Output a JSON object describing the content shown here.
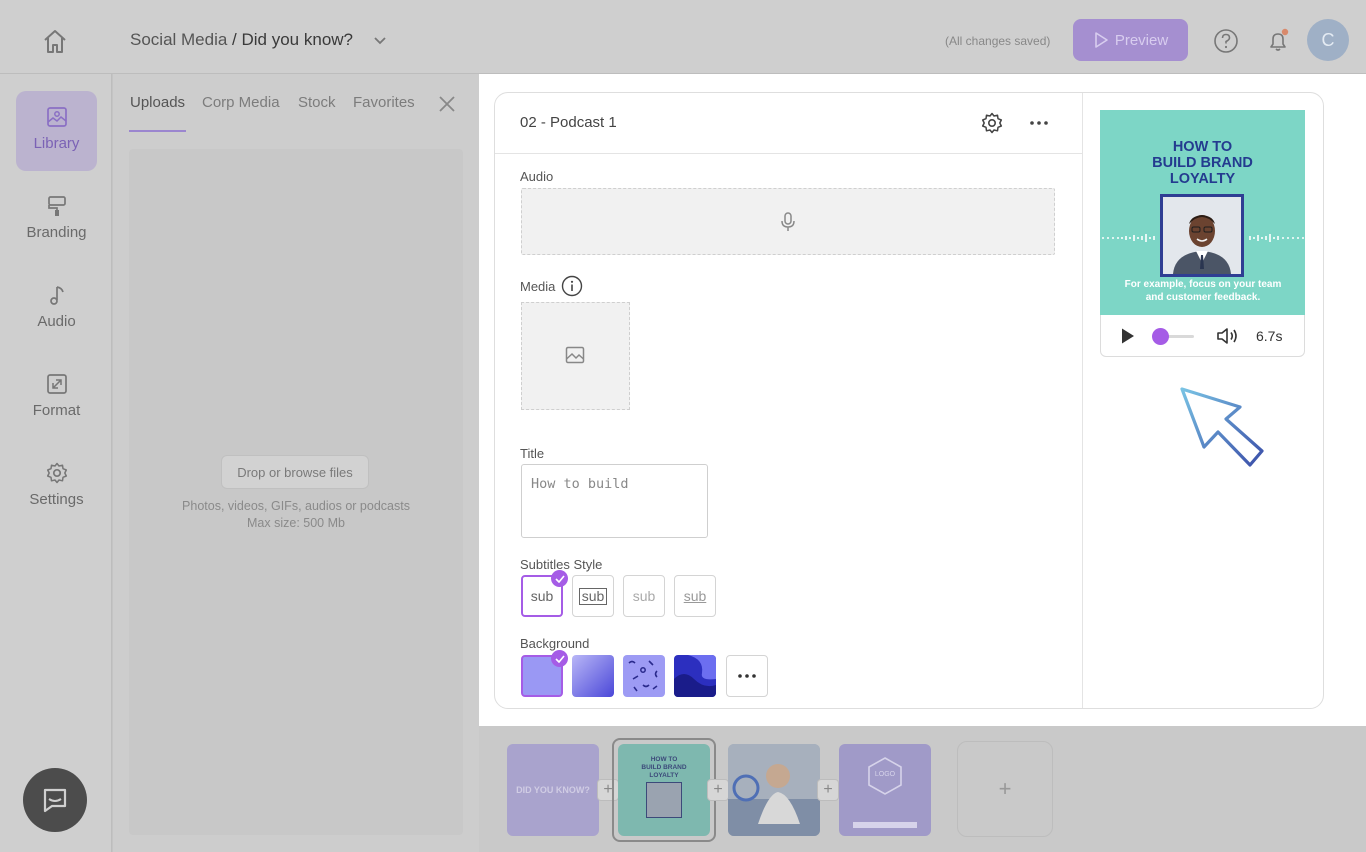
{
  "header": {
    "breadcrumb_parent": "Social Media",
    "breadcrumb_separator": " / ",
    "breadcrumb_current": "Did you know?",
    "save_status": "(All changes saved)",
    "preview_label": "Preview",
    "avatar_initial": "C"
  },
  "rail": {
    "items": [
      {
        "label": "Library",
        "icon": "image-icon",
        "active": true
      },
      {
        "label": "Branding",
        "icon": "paint-roller-icon"
      },
      {
        "label": "Audio",
        "icon": "music-note-icon"
      },
      {
        "label": "Format",
        "icon": "resize-icon"
      },
      {
        "label": "Settings",
        "icon": "gear-icon"
      }
    ]
  },
  "library": {
    "tabs": [
      "Uploads",
      "Corp Media",
      "Stock",
      "Favorites"
    ],
    "active_tab": "Uploads",
    "drop_button": "Drop or browse files",
    "hint_line1": "Photos, videos, GIFs, audios or podcasts",
    "hint_line2": "Max size: 500 Mb"
  },
  "editor": {
    "scene_title": "02 - Podcast 1",
    "audio_label": "Audio",
    "media_label": "Media",
    "title_label": "Title",
    "title_value": "How to build",
    "subtitles_label": "Subtitles Style",
    "subtitle_styles": [
      "sub",
      "sub",
      "sub",
      "sub"
    ],
    "selected_subtitle_style": 0,
    "background_label": "Background",
    "selected_background": 0,
    "accent_color": "#a55ce6"
  },
  "preview": {
    "headline": "HOW TO\nBUILD BRAND\nLOYALTY",
    "caption": "For example, focus on your team\nand customer feedback.",
    "duration": "6.7s",
    "progress": 0.0,
    "bg_color": "#7dd6c6",
    "headline_color": "#243b8f"
  },
  "strip": {
    "thumb1_text": "DID YOU KNOW?",
    "thumb2_text": "HOW TO\nBUILD BRAND\nLOYALTY",
    "thumb4_text": "LOGO",
    "add_symbol": "+"
  }
}
